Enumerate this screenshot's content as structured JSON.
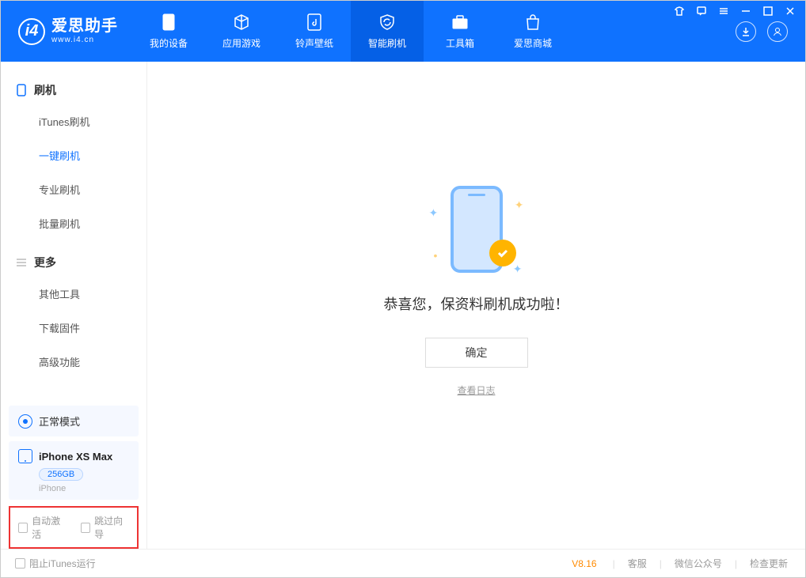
{
  "app": {
    "name_cn": "爱思助手",
    "name_en": "www.i4.cn"
  },
  "nav": {
    "device": "我的设备",
    "apps": "应用游戏",
    "ringtones": "铃声壁纸",
    "flash": "智能刷机",
    "toolbox": "工具箱",
    "store": "爱思商城"
  },
  "sidebar": {
    "section1": "刷机",
    "items1": {
      "itunes": "iTunes刷机",
      "onekey": "一键刷机",
      "pro": "专业刷机",
      "batch": "批量刷机"
    },
    "section2": "更多",
    "items2": {
      "other_tools": "其他工具",
      "download_fw": "下载固件",
      "advanced": "高级功能"
    },
    "mode": "正常模式",
    "device": {
      "name": "iPhone XS Max",
      "capacity": "256GB",
      "type": "iPhone"
    },
    "checks": {
      "auto_activate": "自动激活",
      "skip_guide": "跳过向导"
    }
  },
  "main": {
    "success": "恭喜您，保资料刷机成功啦！",
    "ok": "确定",
    "view_log": "查看日志"
  },
  "footer": {
    "block_itunes": "阻止iTunes运行",
    "version": "V8.16",
    "support": "客服",
    "wechat": "微信公众号",
    "update": "检查更新"
  }
}
